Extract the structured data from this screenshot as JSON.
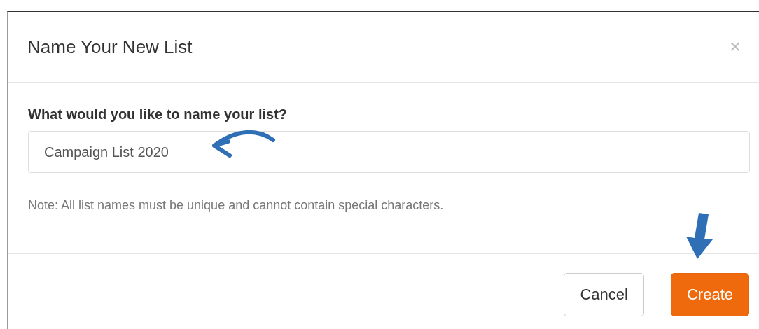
{
  "dialog": {
    "title": "Name Your New List",
    "close": "×"
  },
  "field": {
    "label": "What would you like to name your list?",
    "value": "Campaign List 2020"
  },
  "note": "Note: All list names must be unique and cannot contain special characters.",
  "buttons": [
    {
      "label": "Cancel",
      "kind": "secondary"
    },
    {
      "label": "Create",
      "kind": "primary"
    }
  ]
}
